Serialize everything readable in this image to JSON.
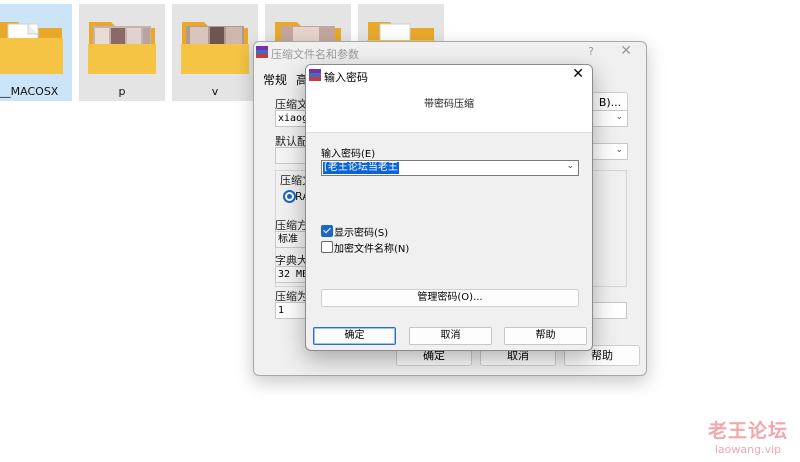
{
  "explorer": {
    "folders": [
      {
        "label": "__MACOSX",
        "selected": true
      },
      {
        "label": "p",
        "selected": false
      },
      {
        "label": "v",
        "selected": false
      },
      {
        "label": "",
        "selected": false
      },
      {
        "label": "",
        "selected": false
      }
    ]
  },
  "archive_dialog": {
    "title": "压缩文件名和参数",
    "help": "?",
    "close": "✕",
    "tabs": [
      "常规",
      "高"
    ],
    "labels": {
      "archive_name": "压缩文",
      "default_profile": "默认配",
      "archive_format": "压缩文",
      "format_option": "RA",
      "compression_method": "压缩方",
      "dictionary_size": "字典大",
      "split_volumes": "压缩为"
    },
    "values": {
      "archive_name": "xiaogu",
      "compression_method": "标准",
      "dictionary_size": "32 MB",
      "split_volumes": "1"
    },
    "browse_button": "B)...",
    "ok_button": "确定",
    "cancel_button": "取消",
    "help_button": "帮助"
  },
  "password_dialog": {
    "title": "输入密码",
    "close": "✕",
    "heading": "带密码压缩",
    "password_label": "输入密码(E)",
    "password_value": "[老王论坛当老王",
    "show_password": {
      "label": "显示密码(S)",
      "checked": true
    },
    "encrypt_names": {
      "label": "加密文件名称(N)",
      "checked": false
    },
    "manage_button": "管理密码(O)...",
    "ok_button": "确定",
    "cancel_button": "取消",
    "help_button": "帮助"
  },
  "watermark": {
    "text": "老王论坛",
    "url": "laowang.vip"
  },
  "colors": {
    "selection_blue": "#0a64d6",
    "folder_yellow": "#f5c445",
    "tile_selected": "#cce4f7",
    "watermark": "#f0a8ae"
  }
}
